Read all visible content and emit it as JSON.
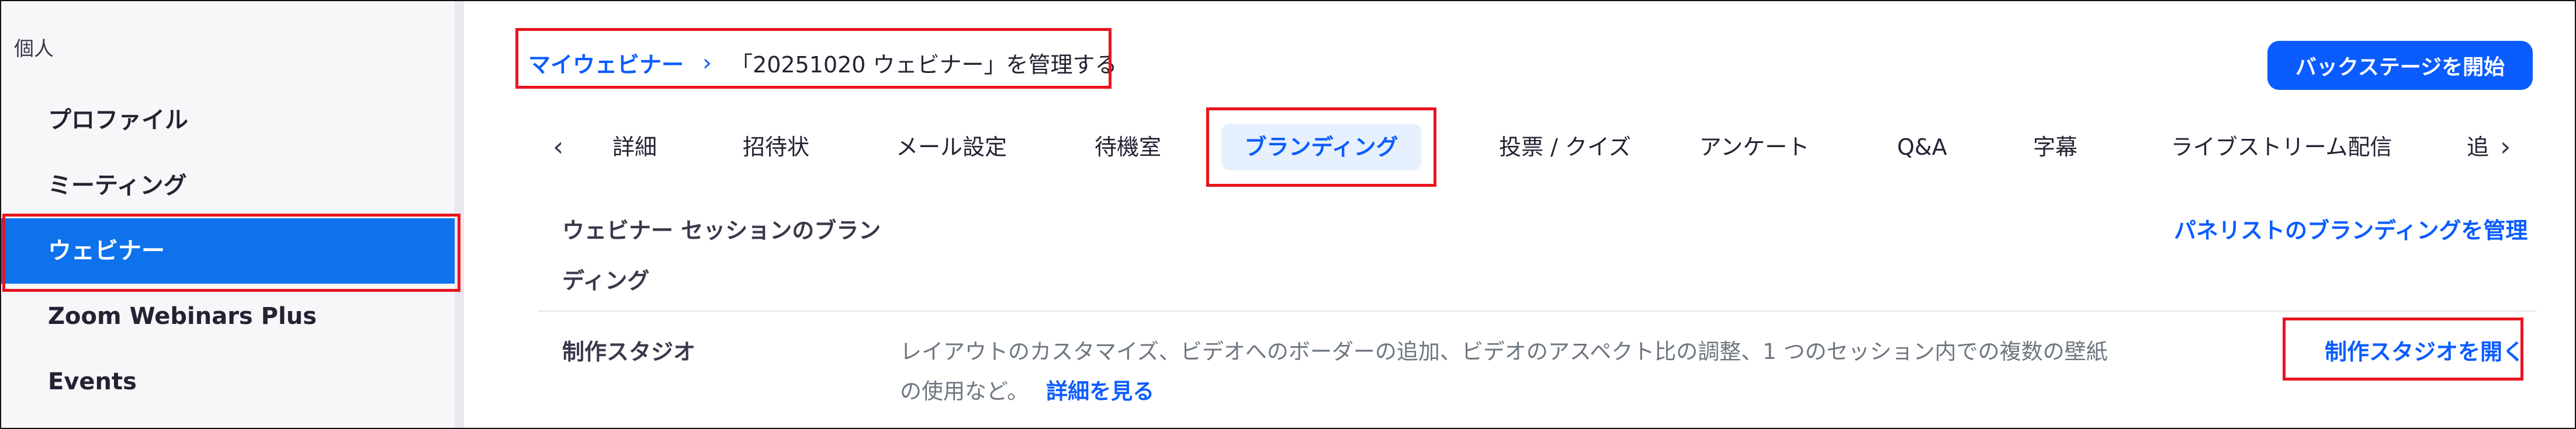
{
  "sidebar": {
    "section_label": "個人",
    "items": [
      {
        "label": "プロファイル",
        "active": false
      },
      {
        "label": "ミーティング",
        "active": false
      },
      {
        "label": "ウェビナー",
        "active": true
      },
      {
        "label": "Zoom Webinars Plus",
        "active": false
      },
      {
        "label": "Events",
        "active": false
      }
    ]
  },
  "header": {
    "breadcrumb_link": "マイウェビナー",
    "breadcrumb_sep": "›",
    "breadcrumb_current": "「20251020 ウェビナー」を管理する",
    "backstage_button": "バックステージを開始"
  },
  "tabs": {
    "prev_icon": "chevron-left-icon",
    "next_icon": "chevron-right-icon",
    "prev_glyph": "‹",
    "next_glyph": "›",
    "items": [
      {
        "label": "詳細"
      },
      {
        "label": "招待状"
      },
      {
        "label": "メール設定"
      },
      {
        "label": "待機室"
      },
      {
        "label": "ブランディング",
        "active": true
      },
      {
        "label": "投票 / クイズ"
      },
      {
        "label": "アンケート"
      },
      {
        "label": "Q&A"
      },
      {
        "label": "字幕"
      },
      {
        "label": "ライブストリーム配信"
      },
      {
        "label": "追"
      }
    ]
  },
  "content": {
    "section_title_line1": "ウェビナー セッションのブラン",
    "section_title_line2": "ディング",
    "manage_panelist_link": "パネリストのブランディングを管理",
    "studio": {
      "label": "制作スタジオ",
      "desc_line1": "レイアウトのカスタマイズ、ビデオへのボーダーの追加、ビデオのアスペクト比の調整、1 つのセッション内での複数の壁紙",
      "desc_line2": "の使用など。",
      "detail_link": "詳細を見る",
      "open_link": "制作スタジオを開く"
    }
  },
  "colors": {
    "accent": "#0b5cff",
    "active_nav": "#0e72ed",
    "highlight_box": "#e8141e"
  }
}
